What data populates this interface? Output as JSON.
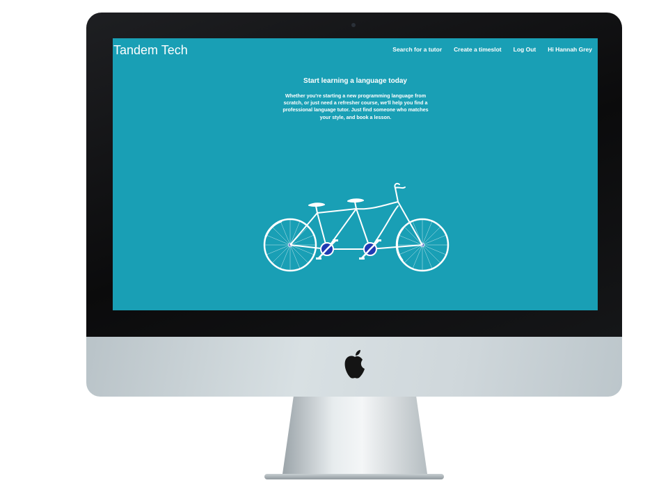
{
  "site": {
    "brand": "Tandem Tech",
    "nav": [
      {
        "label": "Search for a tutor"
      },
      {
        "label": "Create a timeslot"
      },
      {
        "label": "Log Out"
      },
      {
        "label": "Hi Hannah Grey"
      }
    ]
  },
  "hero": {
    "title": "Start learning a language today",
    "body": "Whether you're starting a new programming language from scratch, or just need a refresher course, we'll help you find a professional language tutor. Just find someone who matches your style, and book a lesson."
  },
  "illustration": {
    "icon": "tandem-bicycle-icon"
  },
  "device": {
    "logo": "apple-logo-icon"
  },
  "colors": {
    "screen_bg": "#199fb5",
    "text": "#ffffff",
    "pedal_hub": "#1f3bb3"
  }
}
